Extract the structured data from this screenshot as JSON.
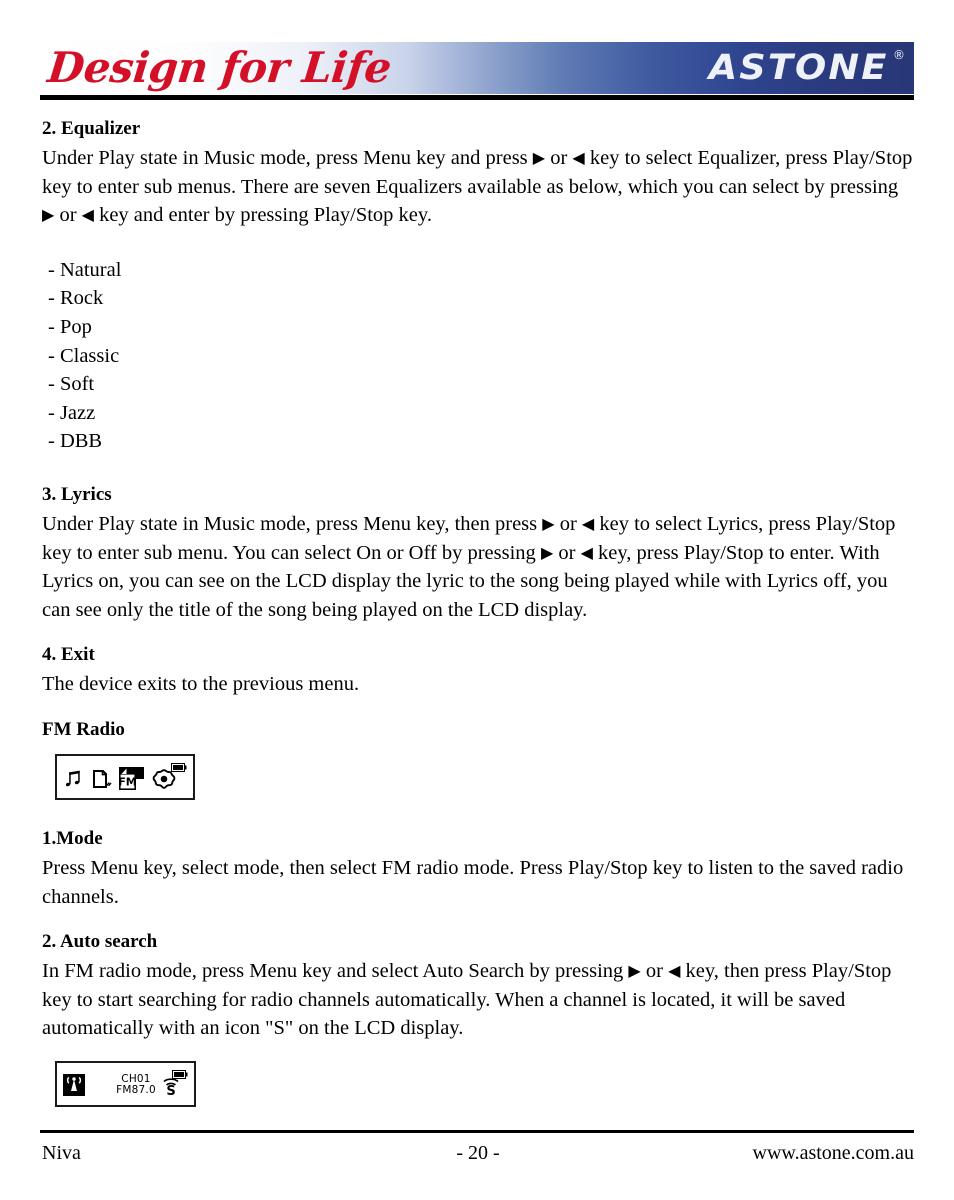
{
  "header": {
    "tagline": "Design for Life",
    "brand": "ASTONE",
    "trademark": "®"
  },
  "sections": {
    "equalizer": {
      "heading": "2. Equalizer",
      "para_1a": "Under Play state in Music mode, press Menu key and press ",
      "arrow_right": "▶",
      "para_1b": " or ",
      "arrow_left": "◀",
      "para_1c": " key to select Equalizer, press Play/Stop key to enter sub menus. There are seven Equalizers available as below, which you can select by pressing ",
      "para_1d": " or ",
      "para_1e": " key and enter by pressing Play/Stop key.",
      "presets": [
        "- Natural",
        "- Rock",
        "- Pop",
        "- Classic",
        "- Soft",
        "- Jazz",
        "- DBB"
      ]
    },
    "lyrics": {
      "heading": "3. Lyrics",
      "para_a": "Under Play state in Music mode, press Menu key, then press ",
      "para_b": " or ",
      "para_c": " key to select Lyrics, press Play/Stop key to enter sub menu. You can select On or Off by pressing ",
      "para_d": " or ",
      "para_e": " key, press Play/Stop to enter. With Lyrics on, you can see on the LCD display the lyric to the song being played while with Lyrics off, you can see only the title of the song being played on the LCD display."
    },
    "exit": {
      "heading": "4. Exit",
      "para": "The device exits to the previous menu."
    },
    "fm_radio": {
      "heading": "FM Radio",
      "lcd_menu": {
        "icons": [
          "music-note-icon",
          "record-file-icon",
          "fm-radio-icon",
          "settings-gear-icon"
        ],
        "selected": "fm-radio-icon",
        "fm_label": "FM",
        "battery": "battery-icon"
      }
    },
    "mode": {
      "heading": "1.Mode",
      "para": "Press Menu key, select mode, then select FM radio mode. Press Play/Stop key to listen to the saved radio channels."
    },
    "auto_search": {
      "heading": "2. Auto search",
      "para_a": "In FM radio mode, press Menu key and select Auto Search by pressing ",
      "para_b": " or ",
      "para_c": " key, then press Play/Stop key to start searching for radio channels automatically. When a channel is located, it will be saved automatically with an icon \"S\" on the LCD display.",
      "lcd_radio": {
        "tower_icon": "radio-tower-icon",
        "channel": "CH01",
        "frequency": "FM87.0",
        "signal_icon": "signal-s-icon",
        "battery": "battery-icon"
      }
    }
  },
  "footer": {
    "left": "Niva",
    "page": "- 20 -",
    "right": "www.astone.com.au"
  },
  "colors": {
    "brand_red": "#d41028",
    "brand_navy": "#283776",
    "ink": "#000000"
  }
}
